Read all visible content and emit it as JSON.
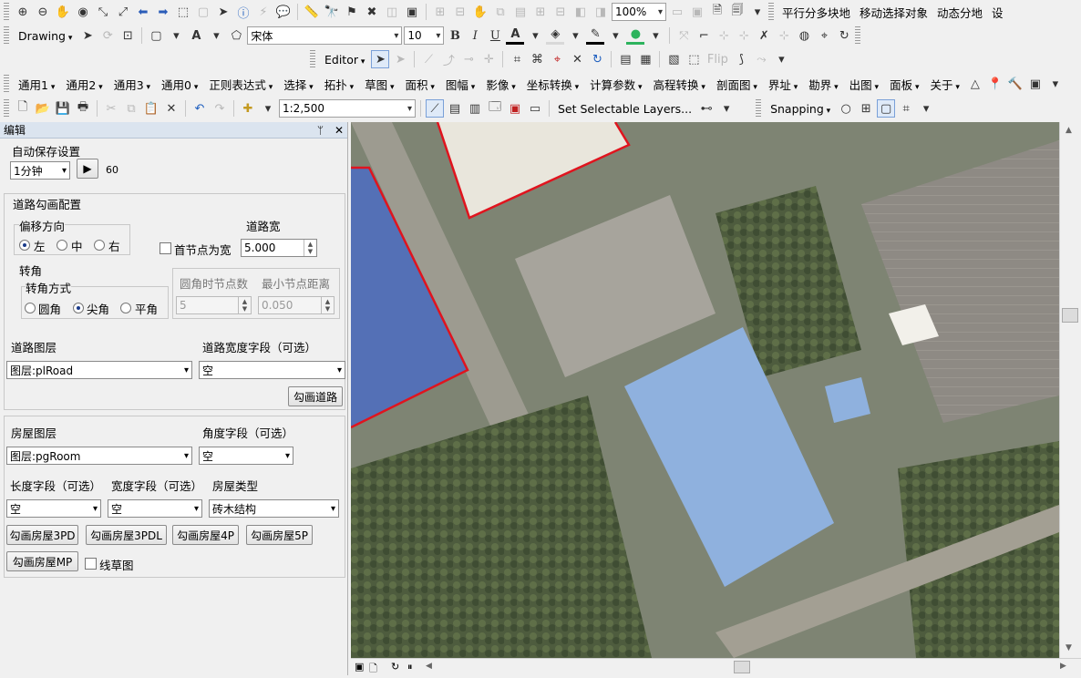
{
  "toolbar1": {
    "zoom": "100%",
    "right_items": [
      "平行分多块地",
      "移动选择对象",
      "动态分地",
      "设"
    ]
  },
  "drawing": {
    "label": "Drawing",
    "font": "宋体",
    "size": "10",
    "bold": "B",
    "italic": "I",
    "underline": "U",
    "text_color_glyph": "A"
  },
  "editor": {
    "label": "Editor",
    "flip": "Flip"
  },
  "menus": [
    "通用1",
    "通用2",
    "通用3",
    "通用0",
    "正则表达式",
    "选择",
    "拓扑",
    "草图",
    "面积",
    "图幅",
    "影像",
    "坐标转换",
    "计算参数",
    "高程转换",
    "剖面图",
    "界址",
    "勘界",
    "出图",
    "面板",
    "关于"
  ],
  "std_toolbar": {
    "scale": "1:2,500",
    "set_selectable": "Set Selectable Layers...",
    "snapping": "Snapping"
  },
  "panel": {
    "title": "编辑",
    "pin": "ᛘ",
    "close": "✕",
    "autosave": {
      "label": "自动保存设置",
      "interval": "1分钟",
      "value": "60"
    },
    "road": {
      "group_title": "道路勾画配置",
      "offset_label": "偏移方向",
      "offset_options": [
        "左",
        "中",
        "右"
      ],
      "first_node_label": "首节点为宽",
      "width_label": "道路宽",
      "width_value": "5.000",
      "corner_label": "转角",
      "corner_mode_label": "转角方式",
      "corner_options": [
        "圆角",
        "尖角",
        "平角"
      ],
      "round_nodes_label": "圆角时节点数",
      "round_nodes_value": "5",
      "min_dist_label": "最小节点距离",
      "min_dist_value": "0.050",
      "layer_label": "道路图层",
      "layer_value": "图层:plRoad",
      "width_field_label": "道路宽度字段（可选）",
      "width_field_value": "空",
      "draw_button": "勾画道路"
    },
    "house": {
      "layer_label": "房屋图层",
      "layer_value": "图层:pgRoom",
      "angle_label": "角度字段（可选）",
      "angle_value": "空",
      "length_label": "长度字段（可选）",
      "length_value": "空",
      "width_label": "宽度字段（可选）",
      "width_value": "空",
      "type_label": "房屋类型",
      "type_value": "砖木结构",
      "buttons": [
        "勾画房屋3PD",
        "勾画房屋3PDL",
        "勾画房屋4P",
        "勾画房屋5P",
        "勾画房屋MP"
      ],
      "sketch_label": "线草图"
    }
  }
}
